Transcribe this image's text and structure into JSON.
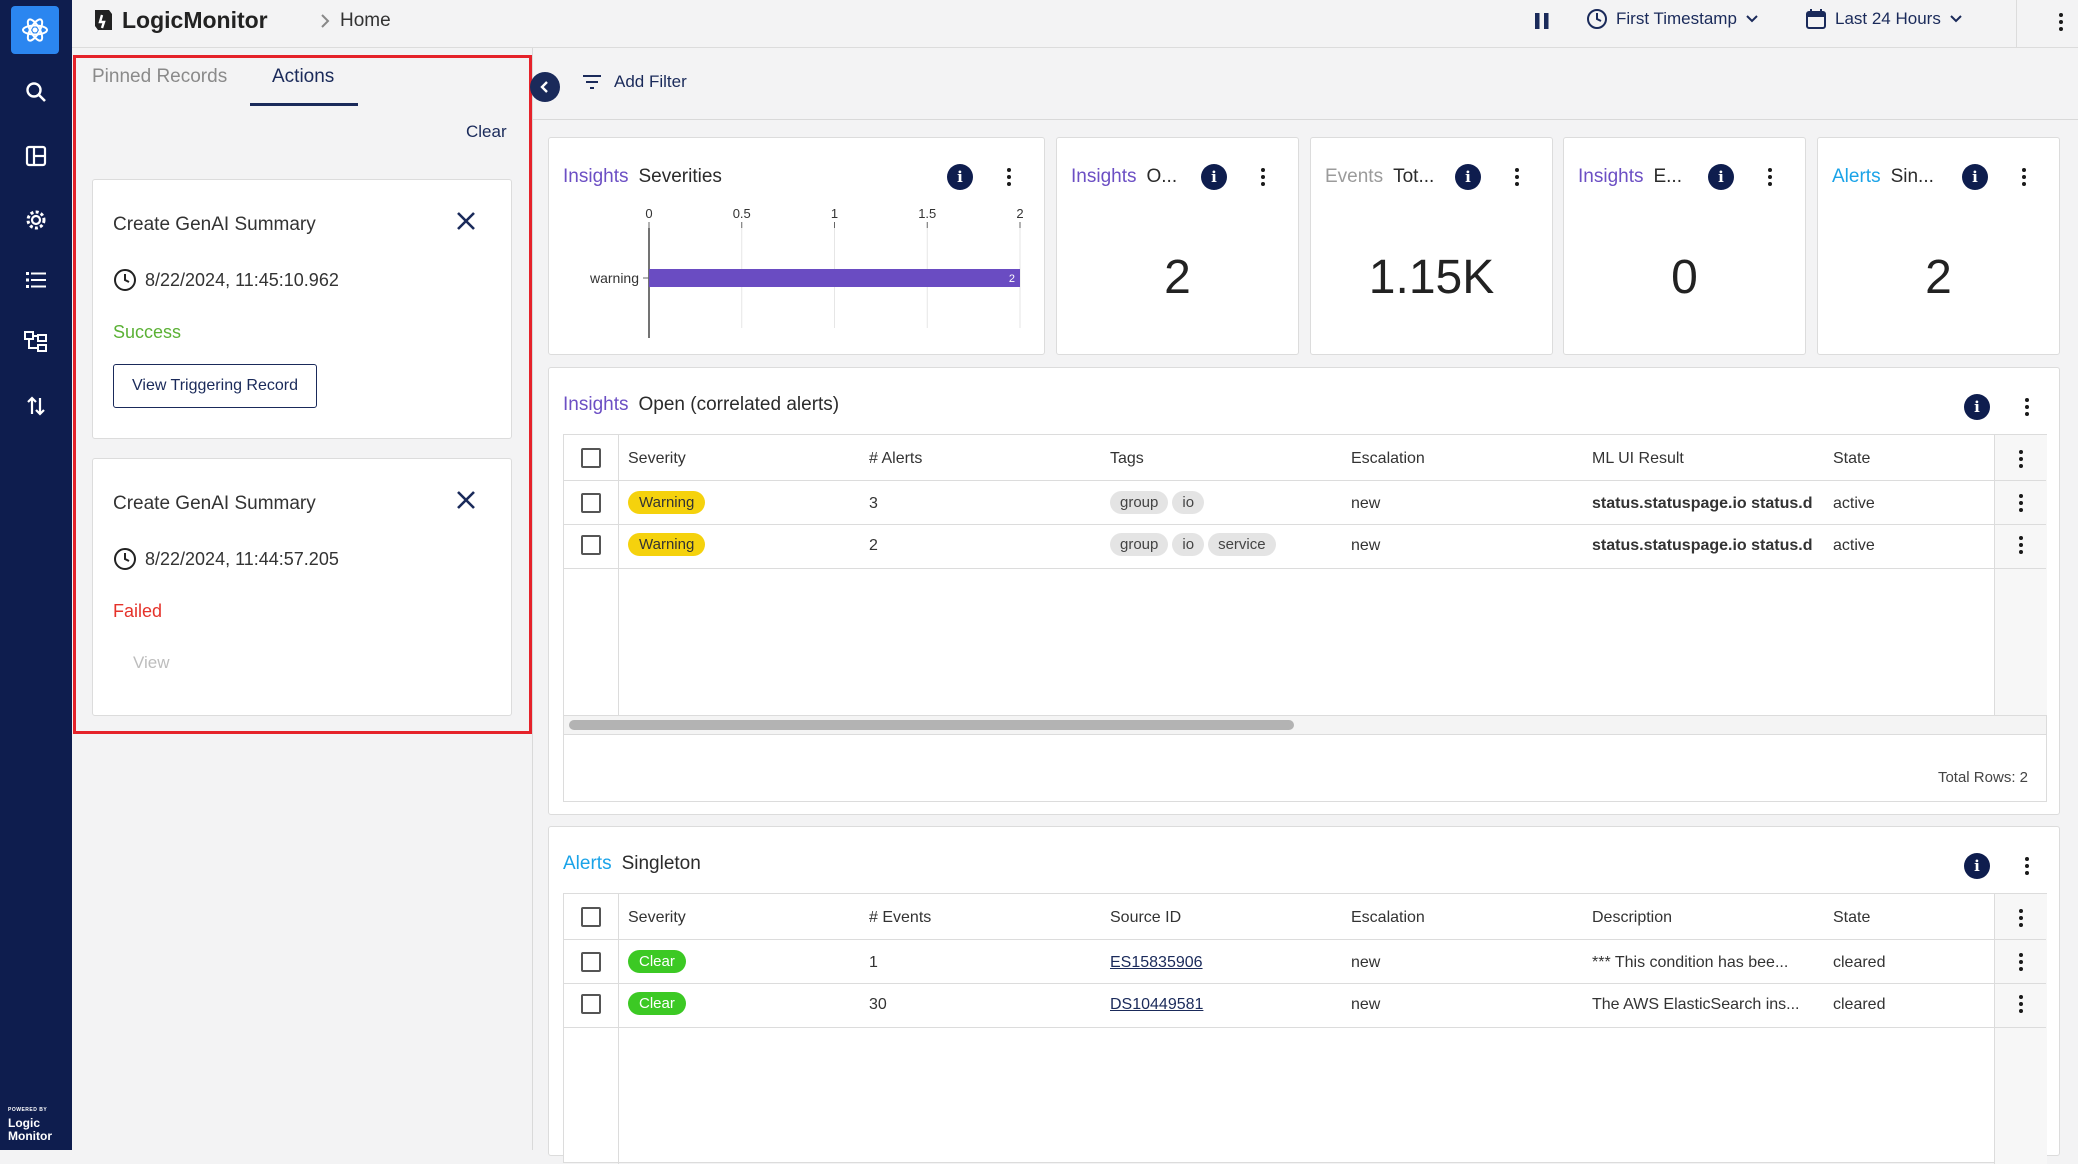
{
  "app": {
    "brand": "LogicMonitor",
    "breadcrumb": "Home"
  },
  "rail": {
    "powered_small": "POWERED BY",
    "powered_line1": "Logic",
    "powered_line2": "Monitor"
  },
  "topbar": {
    "timestamp_label": "First Timestamp",
    "range_label": "Last 24 Hours"
  },
  "panel": {
    "tabs": [
      "Pinned Records",
      "Actions"
    ],
    "active_tab": "Actions",
    "clear_label": "Clear",
    "cards": [
      {
        "title": "Create GenAI Summary",
        "timestamp": "8/22/2024, 11:45:10.962",
        "status": "Success",
        "status_color": "#5bb135",
        "button": "View Triggering Record"
      },
      {
        "title": "Create GenAI Summary",
        "timestamp": "8/22/2024, 11:44:57.205",
        "status": "Failed",
        "status_color": "#e5322a",
        "button": "View"
      }
    ]
  },
  "toolbar": {
    "add_filter": "Add Filter"
  },
  "widgets": {
    "severities": {
      "kind": "Insights",
      "title": "Severities"
    },
    "w1": {
      "kind": "Insights",
      "title": "O...",
      "value": "2"
    },
    "w2": {
      "kind": "Events",
      "title": "Tot...",
      "value": "1.15K"
    },
    "w3": {
      "kind": "Insights",
      "title": "E...",
      "value": "0"
    },
    "w4": {
      "kind": "Alerts",
      "title": "Sin...",
      "value": "2"
    }
  },
  "chart_data": {
    "type": "bar",
    "orientation": "horizontal",
    "categories": [
      "warning"
    ],
    "values": [
      2
    ],
    "data_labels": [
      "2"
    ],
    "x_ticks": [
      "0",
      "0.5",
      "1",
      "1.5",
      "2"
    ],
    "xlim": [
      0,
      2
    ],
    "bar_color": "#6a4cc2",
    "grid": true
  },
  "open_table": {
    "kind": "Insights",
    "title": "Open (correlated alerts)",
    "headers": [
      "Severity",
      "# Alerts",
      "Tags",
      "Escalation",
      "ML UI Result",
      "State"
    ],
    "rows": [
      {
        "severity": "Warning",
        "count": "3",
        "tags": [
          "group",
          "io"
        ],
        "escalation": "new",
        "result": "status.statuspage.io status.d",
        "state": "active"
      },
      {
        "severity": "Warning",
        "count": "2",
        "tags": [
          "group",
          "io",
          "service"
        ],
        "escalation": "new",
        "result": "status.statuspage.io status.d",
        "state": "active"
      }
    ],
    "total_rows": "Total Rows: 2"
  },
  "singleton_table": {
    "kind": "Alerts",
    "title": "Singleton",
    "headers": [
      "Severity",
      "# Events",
      "Source ID",
      "Escalation",
      "Description",
      "State"
    ],
    "rows": [
      {
        "severity": "Clear",
        "count": "1",
        "source": "ES15835906",
        "escalation": "new",
        "description": "*** This condition has bee...",
        "state": "cleared"
      },
      {
        "severity": "Clear",
        "count": "30",
        "source": "DS10449581",
        "escalation": "new",
        "description": "The AWS ElasticSearch ins...",
        "state": "cleared"
      }
    ]
  }
}
